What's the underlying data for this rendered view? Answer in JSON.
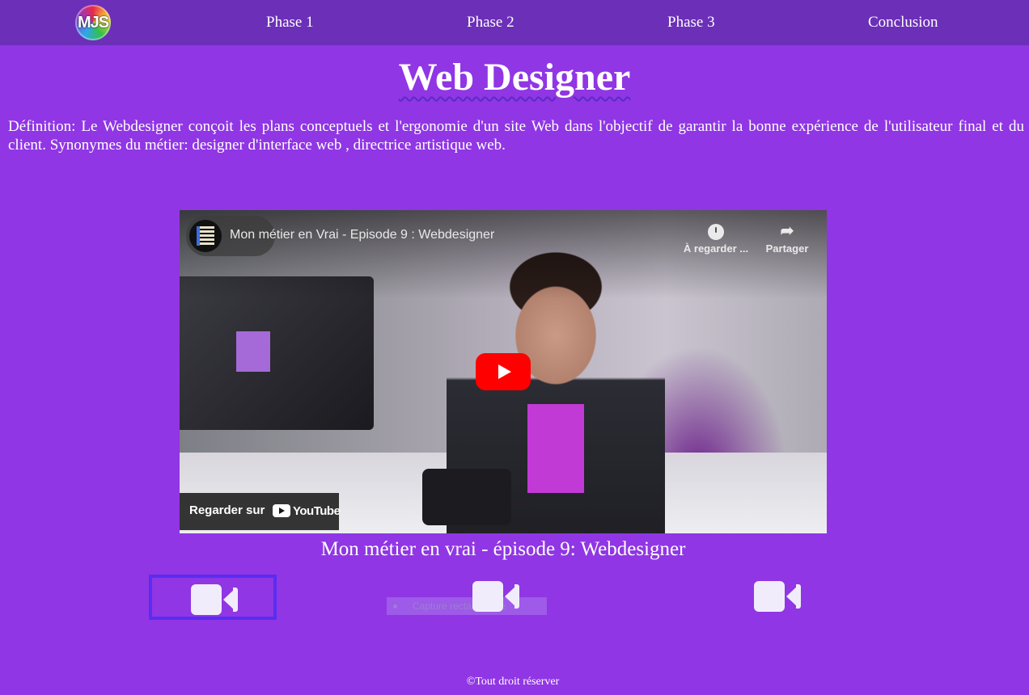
{
  "nav": {
    "logo_text": "MJS",
    "links": [
      {
        "label": "Phase 1"
      },
      {
        "label": "Phase 2"
      },
      {
        "label": "Phase 3"
      },
      {
        "label": "Conclusion"
      }
    ]
  },
  "page": {
    "title": "Web Designer",
    "definition": "Définition: Le Webdesigner conçoit les plans conceptuels et l'ergonomie d'un site Web dans l'objectif de garantir la bonne expérience de l'utilisateur final et du client. Synonymes du métier: designer d'interface web , directrice artistique web."
  },
  "video": {
    "title": "Mon métier en Vrai - Episode 9 : Webdesigner",
    "watch_later_label": "À regarder ...",
    "share_label": "Partager",
    "watch_on_label": "Regarder sur",
    "youtube_word": "YouTube",
    "caption": "Mon métier en vrai - épisode 9: Webdesigner"
  },
  "video_buttons": [
    {
      "icon": "video-camera-icon",
      "active": true
    },
    {
      "icon": "video-camera-icon",
      "active": false
    },
    {
      "icon": "video-camera-icon",
      "active": false
    }
  ],
  "tooltip": {
    "text": "Capture rectangulaire"
  },
  "footer": {
    "text": "©Tout droit réserver"
  },
  "colors": {
    "background": "#9036e4",
    "nav_background": "#6b2fb8",
    "active_border": "#5a2df0",
    "youtube_red": "#ff0000"
  }
}
